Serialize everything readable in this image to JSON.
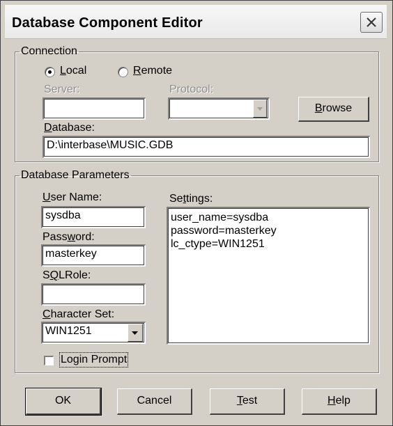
{
  "window": {
    "title": "Database Component Editor"
  },
  "connection": {
    "legend": "Connection",
    "local_label": "Local",
    "remote_label": "Remote",
    "selected": "local",
    "server_label": "Server:",
    "server_value": "",
    "protocol_label": "Protocol:",
    "protocol_value": "",
    "browse_label": "Browse",
    "database_label": "Database:",
    "database_value": "D:\\interbase\\MUSIC.GDB"
  },
  "params": {
    "legend": "Database Parameters",
    "user_name_label": "User Name:",
    "user_name_value": "sysdba",
    "password_label": "Password:",
    "password_value": "masterkey",
    "sqlrole_label": "SQLRole:",
    "sqlrole_value": "",
    "charset_label": "Character Set:",
    "charset_value": "WIN1251",
    "login_prompt_label": "Login Prompt",
    "login_prompt_checked": false,
    "settings_label": "Settings:",
    "settings_lines": [
      "user_name=sysdba",
      "password=masterkey",
      "lc_ctype=WIN1251"
    ]
  },
  "buttons": {
    "ok": "OK",
    "cancel": "Cancel",
    "test": "Test",
    "help": "Help"
  },
  "icons": {
    "close": "close-icon",
    "dropdown": "chevron-down-icon"
  },
  "colors": {
    "face": "#d4d0c8",
    "disabled_text": "#8f8f8f"
  }
}
